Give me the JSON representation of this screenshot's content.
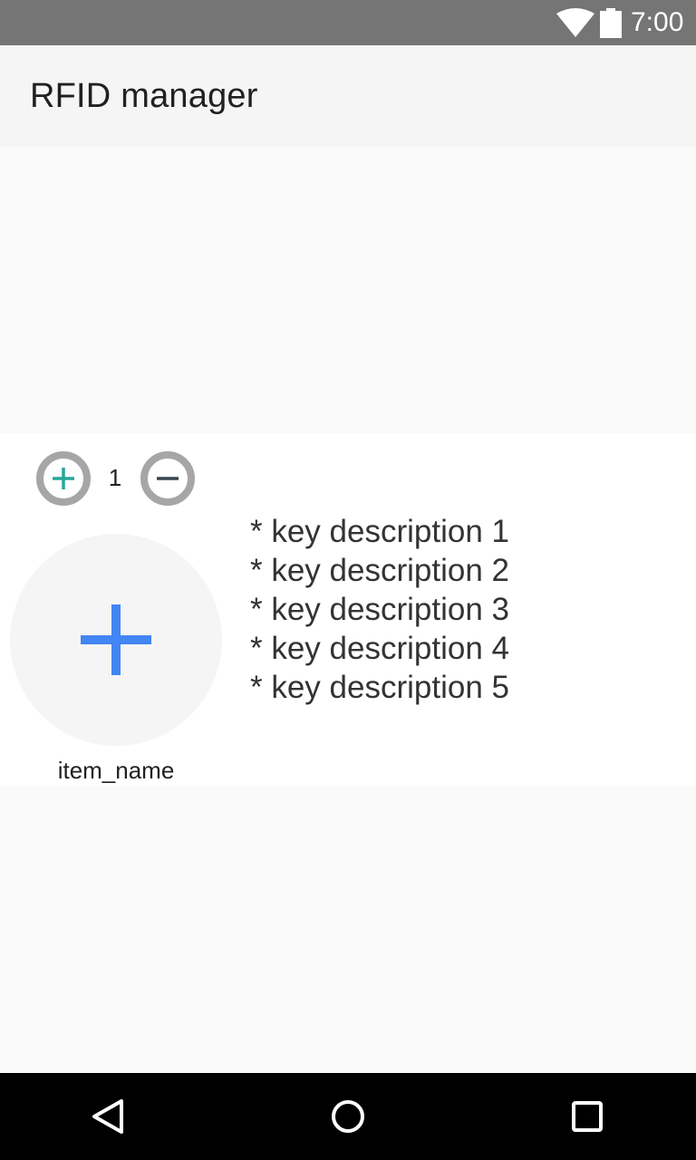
{
  "status_bar": {
    "time": "7:00",
    "icons": [
      "wifi-icon",
      "battery-icon"
    ]
  },
  "app_bar": {
    "title": "RFID manager"
  },
  "item": {
    "quantity": "1",
    "increase_icon": "plus-circle-icon",
    "decrease_icon": "minus-circle-icon",
    "image_icon": "add-icon",
    "name": "item_name",
    "key_descriptions": [
      "* key description 1",
      "* key description 2",
      "* key description 3",
      "* key description 4",
      "* key description 5"
    ]
  },
  "nav_bar": {
    "icons": [
      "back-icon",
      "home-icon",
      "recent-apps-icon"
    ]
  },
  "colors": {
    "status_bar": "#757575",
    "app_bar": "#f5f5f5",
    "background": "#fafafa",
    "card": "#ffffff",
    "accent_plus": "#26a69a",
    "add_icon_blue": "#4285f4",
    "button_ring": "#a6a6a6",
    "nav_bar": "#000000"
  }
}
